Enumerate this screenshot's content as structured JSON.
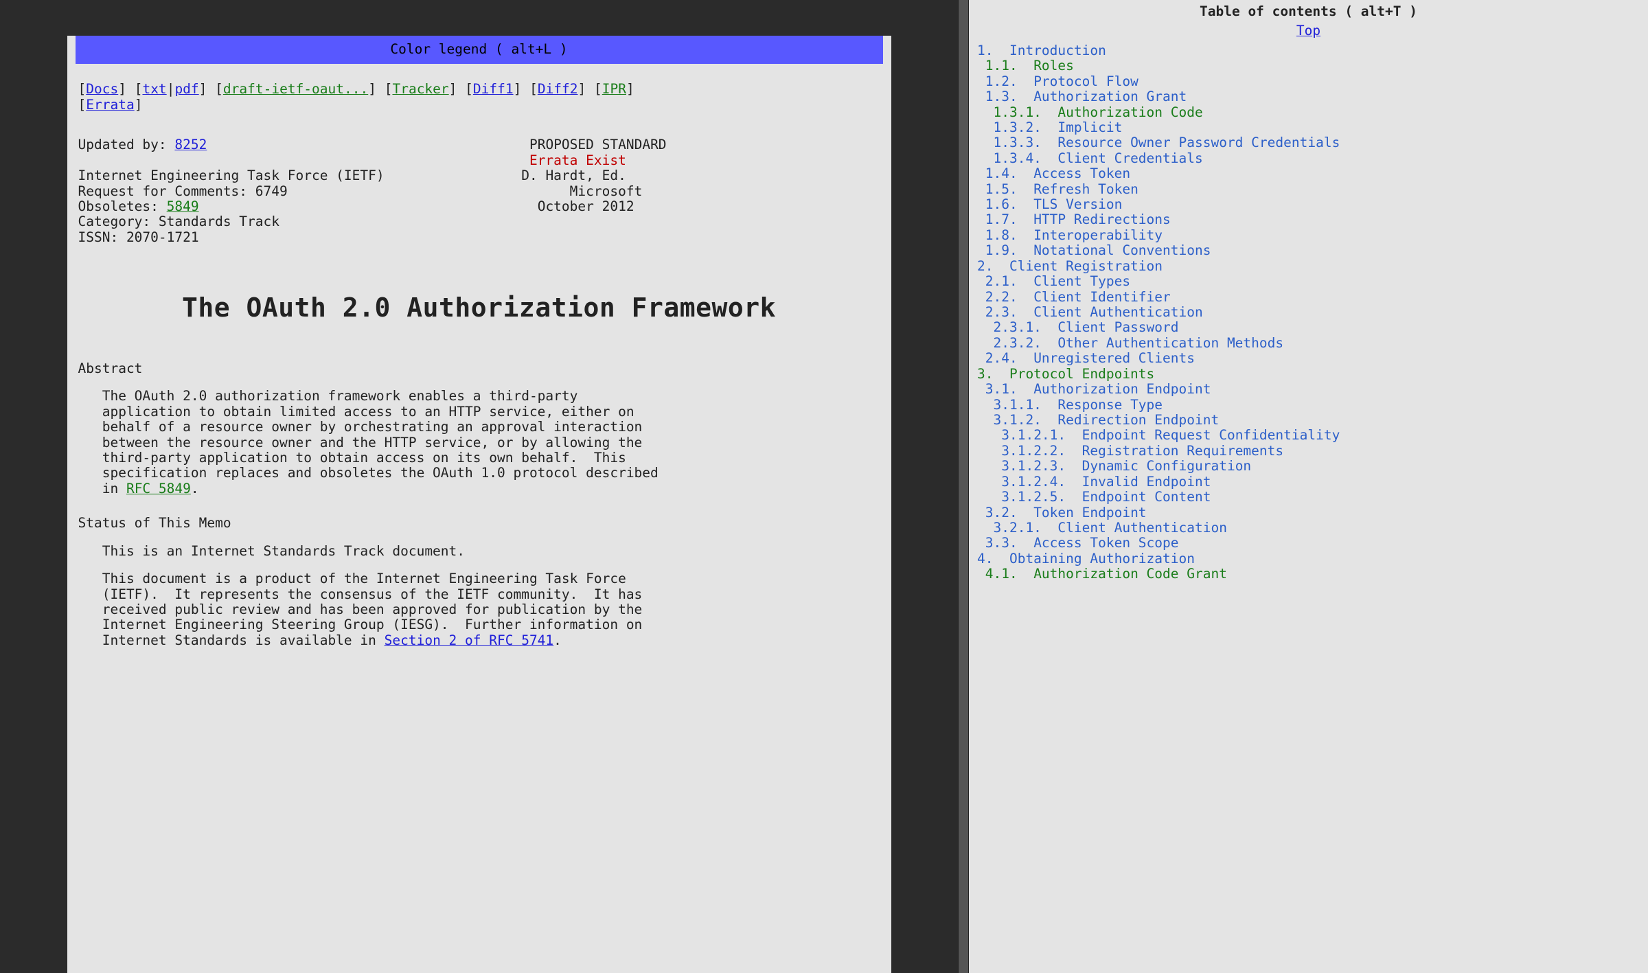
{
  "legend_label": "Color legend ( alt+L )",
  "nav": {
    "docs": "Docs",
    "txt": "txt",
    "pdf": "pdf",
    "draft": "draft-ietf-oaut...",
    "tracker": "Tracker",
    "diff1": "Diff1",
    "diff2": "Diff2",
    "ipr": "IPR",
    "errata": "Errata"
  },
  "header": {
    "updated_label": "Updated by: ",
    "updated_rfc": "8252",
    "status": "PROPOSED STANDARD",
    "errata_exist": "Errata Exist",
    "org": "Internet Engineering Task Force (IETF)",
    "author": "D. Hardt, Ed.",
    "rfc_line": "Request for Comments: 6749",
    "company": "Microsoft",
    "obsoletes_label": "Obsoletes: ",
    "obsoletes_rfc": "5849",
    "date": "October 2012",
    "category": "Category: Standards Track",
    "issn": "ISSN: 2070-1721"
  },
  "title": "The OAuth 2.0 Authorization Framework",
  "abstract": {
    "heading": "Abstract",
    "body_pre": "   The OAuth 2.0 authorization framework enables a third-party\n   application to obtain limited access to an HTTP service, either on\n   behalf of a resource owner by orchestrating an approval interaction\n   between the resource owner and the HTTP service, or by allowing the\n   third-party application to obtain access on its own behalf.  This\n   specification replaces and obsoletes the OAuth 1.0 protocol described\n   in ",
    "rfc_link": "RFC 5849",
    "body_post": "."
  },
  "memo": {
    "heading": "Status of This Memo",
    "para1": "   This is an Internet Standards Track document.",
    "para2_pre": "   This document is a product of the Internet Engineering Task Force\n   (IETF).  It represents the consensus of the IETF community.  It has\n   received public review and has been approved for publication by the\n   Internet Engineering Steering Group (IESG).  Further information on\n   Internet Standards is available in ",
    "para2_link": "Section 2 of RFC 5741",
    "para2_post": "."
  },
  "toc": {
    "title": "Table of contents ( alt+T )",
    "top": "Top",
    "items": [
      {
        "indent": 0,
        "num": "1.",
        "text": "Introduction",
        "style": "blue"
      },
      {
        "indent": 1,
        "num": "1.1.",
        "text": "Roles",
        "style": "green"
      },
      {
        "indent": 1,
        "num": "1.2.",
        "text": "Protocol Flow",
        "style": "blue"
      },
      {
        "indent": 1,
        "num": "1.3.",
        "text": "Authorization Grant",
        "style": "blue"
      },
      {
        "indent": 2,
        "num": "1.3.1.",
        "text": "Authorization Code",
        "style": "green"
      },
      {
        "indent": 2,
        "num": "1.3.2.",
        "text": "Implicit",
        "style": "blue"
      },
      {
        "indent": 2,
        "num": "1.3.3.",
        "text": "Resource Owner Password Credentials",
        "style": "blue"
      },
      {
        "indent": 2,
        "num": "1.3.4.",
        "text": "Client Credentials",
        "style": "blue"
      },
      {
        "indent": 1,
        "num": "1.4.",
        "text": "Access Token",
        "style": "blue"
      },
      {
        "indent": 1,
        "num": "1.5.",
        "text": "Refresh Token",
        "style": "blue"
      },
      {
        "indent": 1,
        "num": "1.6.",
        "text": "TLS Version",
        "style": "blue"
      },
      {
        "indent": 1,
        "num": "1.7.",
        "text": "HTTP Redirections",
        "style": "blue"
      },
      {
        "indent": 1,
        "num": "1.8.",
        "text": "Interoperability",
        "style": "blue"
      },
      {
        "indent": 1,
        "num": "1.9.",
        "text": "Notational Conventions",
        "style": "blue"
      },
      {
        "indent": 0,
        "num": "2.",
        "text": "Client Registration",
        "style": "blue"
      },
      {
        "indent": 1,
        "num": "2.1.",
        "text": "Client Types",
        "style": "blue"
      },
      {
        "indent": 1,
        "num": "2.2.",
        "text": "Client Identifier",
        "style": "blue"
      },
      {
        "indent": 1,
        "num": "2.3.",
        "text": "Client Authentication",
        "style": "blue"
      },
      {
        "indent": 2,
        "num": "2.3.1.",
        "text": "Client Password",
        "style": "blue"
      },
      {
        "indent": 2,
        "num": "2.3.2.",
        "text": "Other Authentication Methods",
        "style": "blue"
      },
      {
        "indent": 1,
        "num": "2.4.",
        "text": "Unregistered Clients",
        "style": "blue"
      },
      {
        "indent": 0,
        "num": "3.",
        "text": "Protocol Endpoints",
        "style": "green"
      },
      {
        "indent": 1,
        "num": "3.1.",
        "text": "Authorization Endpoint",
        "style": "blue"
      },
      {
        "indent": 2,
        "num": "3.1.1.",
        "text": "Response Type",
        "style": "blue"
      },
      {
        "indent": 2,
        "num": "3.1.2.",
        "text": "Redirection Endpoint",
        "style": "blue"
      },
      {
        "indent": 3,
        "num": "3.1.2.1.",
        "text": "Endpoint Request Confidentiality",
        "style": "blue"
      },
      {
        "indent": 3,
        "num": "3.1.2.2.",
        "text": "Registration Requirements",
        "style": "blue"
      },
      {
        "indent": 3,
        "num": "3.1.2.3.",
        "text": "Dynamic Configuration",
        "style": "blue"
      },
      {
        "indent": 3,
        "num": "3.1.2.4.",
        "text": "Invalid Endpoint",
        "style": "blue"
      },
      {
        "indent": 3,
        "num": "3.1.2.5.",
        "text": "Endpoint Content",
        "style": "blue"
      },
      {
        "indent": 1,
        "num": "3.2.",
        "text": "Token Endpoint",
        "style": "blue"
      },
      {
        "indent": 2,
        "num": "3.2.1.",
        "text": "Client Authentication",
        "style": "blue"
      },
      {
        "indent": 1,
        "num": "3.3.",
        "text": "Access Token Scope",
        "style": "blue"
      },
      {
        "indent": 0,
        "num": "4.",
        "text": "Obtaining Authorization",
        "style": "blue"
      },
      {
        "indent": 1,
        "num": "4.1.",
        "text": "Authorization Code Grant",
        "style": "green"
      }
    ]
  }
}
